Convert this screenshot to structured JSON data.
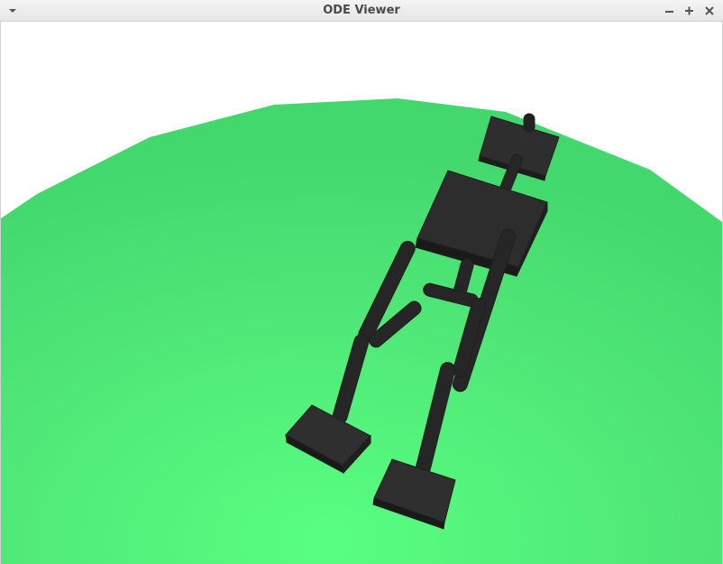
{
  "window": {
    "title": "ODE Viewer",
    "controls": {
      "menu_icon": "chevron-down-icon",
      "minimize_icon": "minimize-icon",
      "maximize_icon": "maximize-icon",
      "close_icon": "close-icon"
    }
  },
  "scene": {
    "background_color": "#ffffff",
    "ground_color": "#4fe677",
    "robot_color": "#2b2b2b"
  }
}
